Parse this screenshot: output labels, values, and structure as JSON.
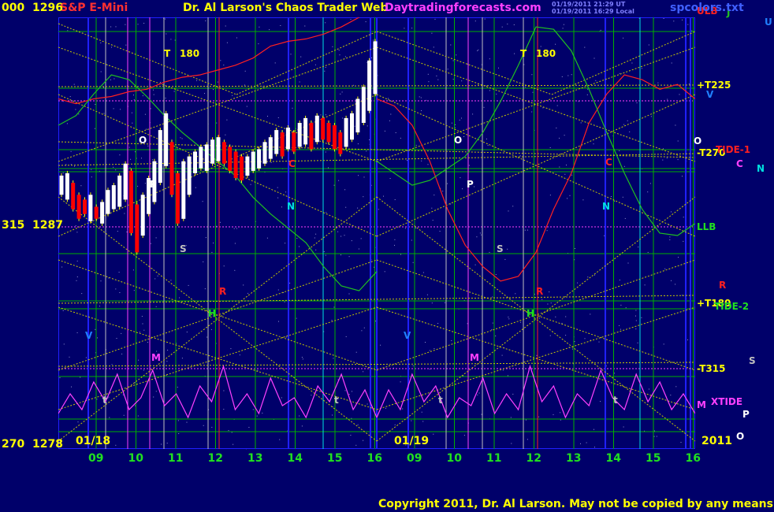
{
  "header": {
    "instrument": "S&P E-Mini",
    "site_title": "Dr. Al Larson's Chaos Trader Web",
    "site_url": "Daytradingforecasts.com",
    "stamp_line1": "01/19/2011 21:29 UT",
    "stamp_line2": "01/19/2011 16:29 Local",
    "file": "spcolors.txt",
    "copyright": "Copyright 2011, Dr. Al Larson. May not be copied by any means."
  },
  "colors": {
    "background": "#00006a",
    "price_bar": "#ffffff",
    "price_bar_down": "#ff0000",
    "price_wick": "#ffff00",
    "red_line": "#ff2020",
    "green_line": "#20c020",
    "magenta_line": "#ff40ff",
    "grid_yellow": "#c8c800",
    "grid_green": "#00b000",
    "vline_blue": "#2020ff"
  },
  "chart_data": {
    "type": "bar",
    "title": "S&P E-Mini",
    "y_left_labels": [
      {
        "text": "000",
        "value": 1296
      },
      {
        "text": "315",
        "value": 1287
      },
      {
        "text": "270",
        "value": 1278
      }
    ],
    "ylim": [
      1278,
      1296
    ],
    "dates": [
      "01/18",
      "01/19"
    ],
    "x_hours": [
      "09",
      "10",
      "11",
      "12",
      "13",
      "14",
      "15",
      "16",
      "09",
      "10",
      "11",
      "12",
      "13",
      "14",
      "15",
      "16"
    ],
    "year": "2011",
    "right_labels": [
      {
        "text": "ULB",
        "color": "#ff2020"
      },
      {
        "text": "J",
        "color": "#20c020"
      },
      {
        "text": "U",
        "color": "#2080ff"
      },
      {
        "text": "+T225",
        "color": "#ffff00"
      },
      {
        "text": "V",
        "color": "#2080ff"
      },
      {
        "text": "O",
        "color": "#ffffff"
      },
      {
        "text": "-T270",
        "color": "#ffff00"
      },
      {
        "text": "TIDE-1",
        "color": "#ff2020"
      },
      {
        "text": "C",
        "color": "#ff40ff"
      },
      {
        "text": "N",
        "color": "#00e0e0"
      },
      {
        "text": "LLB",
        "color": "#20e020"
      },
      {
        "text": "R",
        "color": "#ff2020"
      },
      {
        "text": "+T180",
        "color": "#ffff00"
      },
      {
        "text": "TIDE-2",
        "color": "#20e020"
      },
      {
        "text": "-T315",
        "color": "#ffff00"
      },
      {
        "text": "S",
        "color": "#c0c0c0"
      },
      {
        "text": "M",
        "color": "#ff40ff"
      },
      {
        "text": "XTIDE",
        "color": "#ff40ff"
      },
      {
        "text": "P",
        "color": "#ffffff"
      },
      {
        "text": "O",
        "color": "#ffffff"
      }
    ],
    "annotations": [
      {
        "text": "T",
        "color": "#ffff00"
      },
      {
        "text": "180",
        "color": "#ffff00"
      },
      {
        "text": "T",
        "color": "#ffff00"
      },
      {
        "text": "180",
        "color": "#ffff00"
      },
      {
        "text": "O",
        "color": "#ffffff"
      },
      {
        "text": "O",
        "color": "#ffffff"
      },
      {
        "text": "P",
        "color": "#ffffff"
      },
      {
        "text": "P",
        "color": "#ffffff"
      },
      {
        "text": "C",
        "color": "#ff2020"
      },
      {
        "text": "C",
        "color": "#ff2020"
      },
      {
        "text": "N",
        "color": "#00e0e0"
      },
      {
        "text": "N",
        "color": "#00e0e0"
      },
      {
        "text": "S",
        "color": "#c0c0c0"
      },
      {
        "text": "S",
        "color": "#c0c0c0"
      },
      {
        "text": "R",
        "color": "#ff2020"
      },
      {
        "text": "R",
        "color": "#ff2020"
      },
      {
        "text": "H",
        "color": "#20e020"
      },
      {
        "text": "H",
        "color": "#20e020"
      },
      {
        "text": "V",
        "color": "#2080ff"
      },
      {
        "text": "V",
        "color": "#2080ff"
      },
      {
        "text": "M",
        "color": "#ff40ff"
      },
      {
        "text": "M",
        "color": "#ff40ff"
      },
      {
        "text": "t",
        "color": "#c0c0c0"
      },
      {
        "text": "t",
        "color": "#c0c0c0"
      },
      {
        "text": "t",
        "color": "#c0c0c0"
      },
      {
        "text": "t",
        "color": "#c0c0c0"
      }
    ],
    "price_bars": [
      [
        1288.6,
        1289.4
      ],
      [
        1288.4,
        1289.5
      ],
      [
        1288.0,
        1289.1
      ],
      [
        1287.6,
        1288.6
      ],
      [
        1287.8,
        1288.4
      ],
      [
        1287.5,
        1288.6
      ],
      [
        1287.6,
        1288.1
      ],
      [
        1287.4,
        1288.3
      ],
      [
        1287.8,
        1288.8
      ],
      [
        1288.0,
        1289.0
      ],
      [
        1288.1,
        1289.4
      ],
      [
        1288.4,
        1289.9
      ],
      [
        1287.0,
        1289.6
      ],
      [
        1286.2,
        1288.2
      ],
      [
        1286.9,
        1288.6
      ],
      [
        1287.8,
        1289.3
      ],
      [
        1288.3,
        1290.0
      ],
      [
        1289.1,
        1291.3
      ],
      [
        1289.8,
        1292.0
      ],
      [
        1288.6,
        1290.8
      ],
      [
        1287.4,
        1289.5
      ],
      [
        1287.6,
        1290.0
      ],
      [
        1288.6,
        1290.2
      ],
      [
        1289.5,
        1290.4
      ],
      [
        1289.7,
        1290.6
      ],
      [
        1289.6,
        1290.7
      ],
      [
        1289.9,
        1290.9
      ],
      [
        1290.0,
        1291.0
      ],
      [
        1289.9,
        1290.8
      ],
      [
        1289.6,
        1290.6
      ],
      [
        1289.3,
        1290.4
      ],
      [
        1289.2,
        1290.2
      ],
      [
        1289.4,
        1290.2
      ],
      [
        1289.6,
        1290.4
      ],
      [
        1289.7,
        1290.5
      ],
      [
        1289.9,
        1290.8
      ],
      [
        1290.1,
        1291.0
      ],
      [
        1290.3,
        1291.3
      ],
      [
        1290.2,
        1291.2
      ],
      [
        1290.5,
        1291.4
      ],
      [
        1290.4,
        1291.2
      ],
      [
        1290.6,
        1291.6
      ],
      [
        1290.7,
        1291.8
      ],
      [
        1290.5,
        1291.6
      ],
      [
        1290.8,
        1291.9
      ],
      [
        1290.9,
        1291.8
      ],
      [
        1290.8,
        1291.6
      ],
      [
        1290.5,
        1291.5
      ],
      [
        1290.3,
        1291.2
      ],
      [
        1290.6,
        1291.8
      ],
      [
        1290.9,
        1292.0
      ],
      [
        1291.2,
        1292.6
      ],
      [
        1291.6,
        1293.1
      ],
      [
        1292.1,
        1294.2
      ],
      [
        1292.8,
        1295.0
      ]
    ],
    "red_line": [
      1292.6,
      1292.4,
      1292.6,
      1292.7,
      1292.9,
      1293.0,
      1293.3,
      1293.5,
      1293.6,
      1293.8,
      1294.0,
      1294.3,
      1294.8,
      1295.0,
      1295.1,
      1295.3,
      1295.6,
      1296.0,
      1296.4
    ],
    "red_line2": [
      1292.6,
      1292.3,
      1291.5,
      1290.0,
      1288.0,
      1286.5,
      1285.6,
      1285.0,
      1285.2,
      1286.2,
      1288.0,
      1289.5,
      1291.6,
      1292.8,
      1293.6,
      1293.4,
      1293.0,
      1293.2,
      1292.6
    ],
    "green_line": [
      1291.5,
      1291.9,
      1292.8,
      1293.6,
      1293.4,
      1292.7,
      1291.9,
      1291.2,
      1290.6,
      1290.0,
      1289.4,
      1288.5,
      1287.8,
      1287.2,
      1286.6,
      1285.6,
      1284.8,
      1284.6,
      1285.4
    ],
    "green_line2": [
      1290.0,
      1289.5,
      1289.0,
      1289.2,
      1289.7,
      1290.2,
      1291.2,
      1292.5,
      1294.0,
      1295.6,
      1295.5,
      1294.6,
      1293.0,
      1291.2,
      1289.5,
      1288.0,
      1287.0,
      1286.9,
      1287.4
    ],
    "magenta_tide": [
      0.35,
      0.6,
      0.4,
      0.75,
      0.5,
      0.85,
      0.4,
      0.55,
      0.9,
      0.45,
      0.6,
      0.3,
      0.7,
      0.5,
      0.95,
      0.4,
      0.6,
      0.35,
      0.8,
      0.45,
      0.55,
      0.3,
      0.7,
      0.5,
      0.85,
      0.4,
      0.65,
      0.3
    ]
  }
}
